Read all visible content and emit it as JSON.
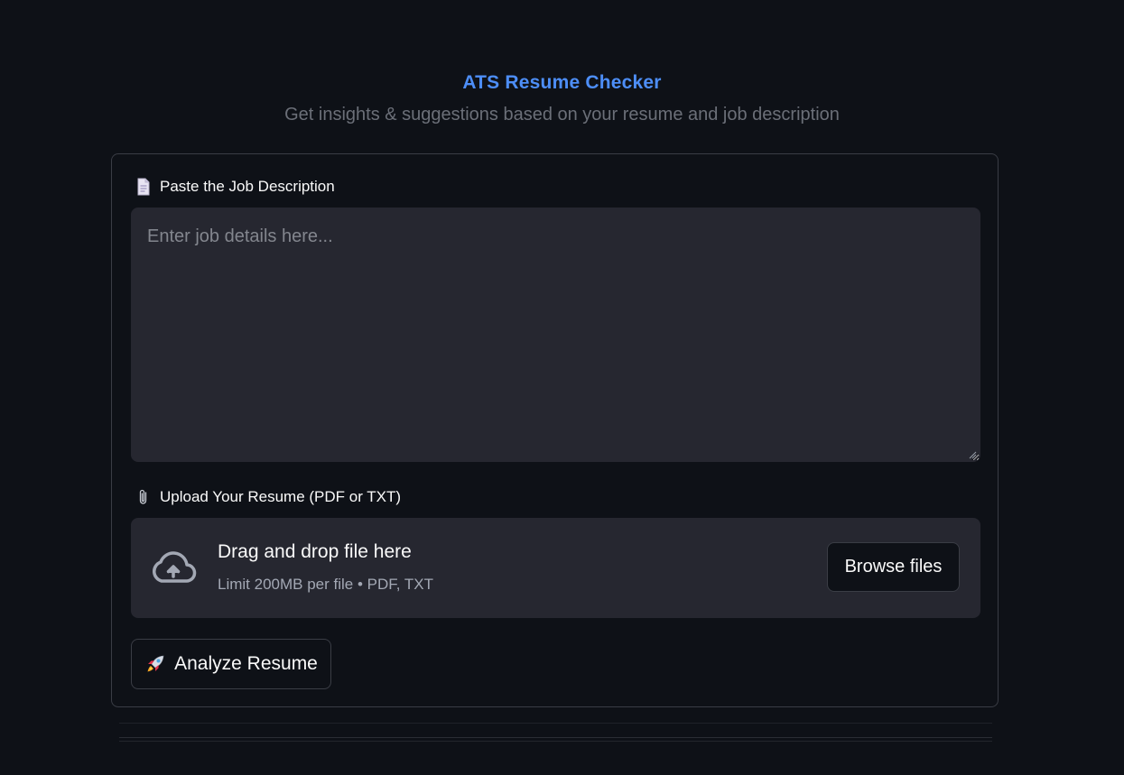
{
  "header": {
    "title": "ATS Resume Checker",
    "subtitle": "Get insights & suggestions based on your resume and job description"
  },
  "job_description": {
    "icon": "document-icon",
    "label": "Paste the Job Description",
    "placeholder": "Enter job details here...",
    "value": ""
  },
  "resume_upload": {
    "icon": "paperclip-icon",
    "label": "Upload Your Resume (PDF or TXT)",
    "dropzone_icon": "cloud-upload-icon",
    "dropzone_title": "Drag and drop file here",
    "dropzone_hint": "Limit 200MB per file • PDF, TXT",
    "browse_label": "Browse files"
  },
  "actions": {
    "analyze_icon": "rocket-icon",
    "analyze_label": "Analyze Resume"
  },
  "colors": {
    "background": "#0e1117",
    "accent": "#4d8ef7",
    "input_bg": "#262730",
    "border": "#3a3d45"
  }
}
